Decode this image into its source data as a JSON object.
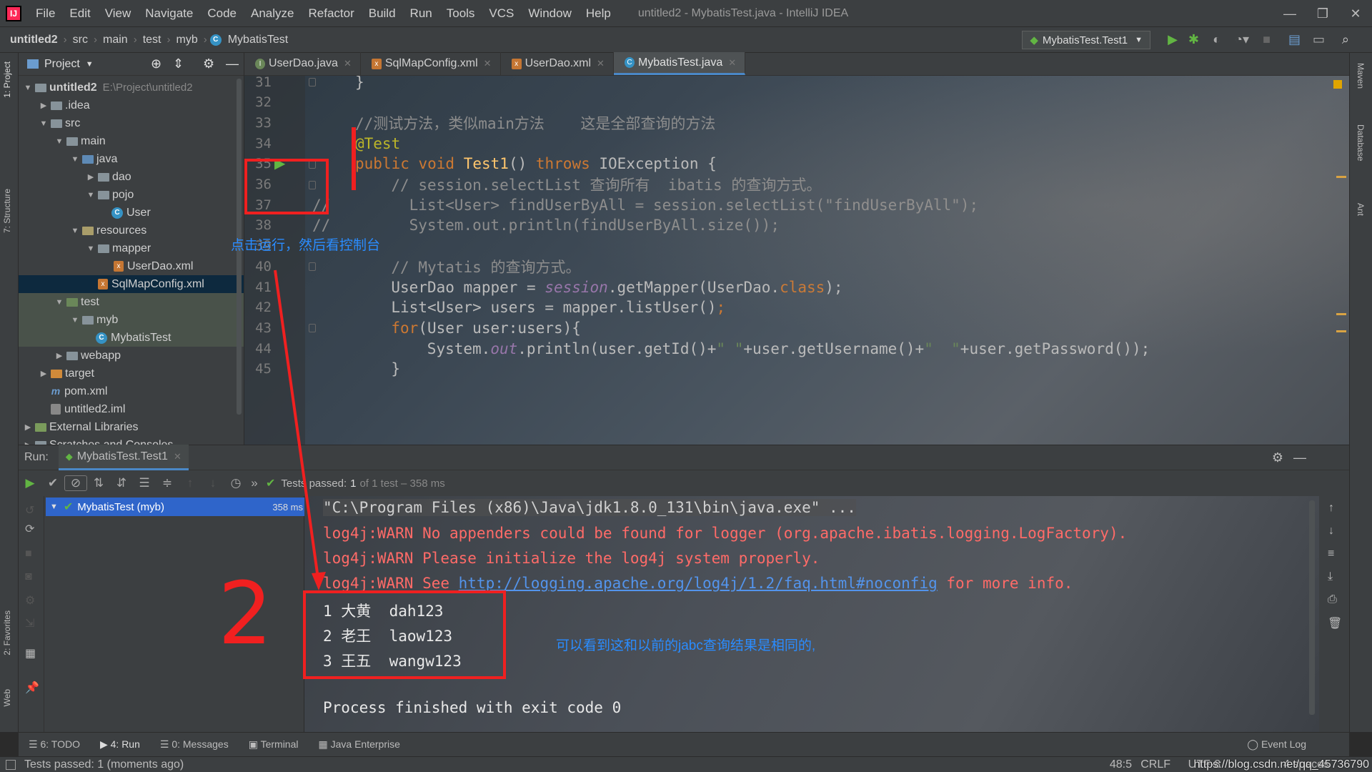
{
  "app": {
    "logo": "IJ"
  },
  "menu": [
    "File",
    "Edit",
    "View",
    "Navigate",
    "Code",
    "Analyze",
    "Refactor",
    "Build",
    "Run",
    "Tools",
    "VCS",
    "Window",
    "Help"
  ],
  "window_title": "untitled2 - MybatisTest.java - IntelliJ IDEA",
  "breadcrumb": [
    "untitled2",
    "src",
    "main",
    "test",
    "myb",
    "MybatisTest"
  ],
  "run_config": "MybatisTest.Test1",
  "left_tabs": [
    "1: Project",
    "7: Structure",
    "2: Favorites",
    "Web"
  ],
  "right_tabs": [
    "Maven",
    "Database",
    "Ant"
  ],
  "project": {
    "header": "Project",
    "tree": [
      {
        "label": "untitled2",
        "extra": "E:\\Project\\untitled2",
        "depth": 0,
        "arrow": "▼",
        "icon": "folder"
      },
      {
        "label": ".idea",
        "depth": 1,
        "arrow": "▶",
        "icon": "folder"
      },
      {
        "label": "src",
        "depth": 1,
        "arrow": "▼",
        "icon": "folder"
      },
      {
        "label": "main",
        "depth": 2,
        "arrow": "▼",
        "icon": "folder"
      },
      {
        "label": "java",
        "depth": 3,
        "arrow": "▼",
        "icon": "src"
      },
      {
        "label": "dao",
        "depth": 4,
        "arrow": "▶",
        "icon": "folder"
      },
      {
        "label": "pojo",
        "depth": 4,
        "arrow": "▼",
        "icon": "folder"
      },
      {
        "label": "User",
        "depth": 5,
        "arrow": "",
        "icon": "class"
      },
      {
        "label": "resources",
        "depth": 3,
        "arrow": "▼",
        "icon": "res"
      },
      {
        "label": "mapper",
        "depth": 4,
        "arrow": "▼",
        "icon": "folder"
      },
      {
        "label": "UserDao.xml",
        "depth": 5,
        "arrow": "",
        "icon": "xml"
      },
      {
        "label": "SqlMapConfig.xml",
        "depth": 4,
        "arrow": "",
        "icon": "xml"
      },
      {
        "label": "test",
        "depth": 2,
        "arrow": "▼",
        "icon": "test"
      },
      {
        "label": "myb",
        "depth": 3,
        "arrow": "▼",
        "icon": "folder"
      },
      {
        "label": "MybatisTest",
        "depth": 4,
        "arrow": "",
        "icon": "class"
      },
      {
        "label": "webapp",
        "depth": 2,
        "arrow": "▶",
        "icon": "folder"
      },
      {
        "label": "target",
        "depth": 1,
        "arrow": "▶",
        "icon": "orange"
      },
      {
        "label": "pom.xml",
        "depth": 1,
        "arrow": "",
        "icon": "maven"
      },
      {
        "label": "untitled2.iml",
        "depth": 1,
        "arrow": "",
        "icon": "iml"
      },
      {
        "label": "External Libraries",
        "depth": 0,
        "arrow": "▶",
        "icon": "lib"
      },
      {
        "label": "Scratches and Consoles",
        "depth": 0,
        "arrow": "▶",
        "icon": "folder"
      }
    ]
  },
  "editor_tabs": [
    {
      "label": "UserDao.java",
      "icon": "I",
      "color": "#6a8759"
    },
    {
      "label": "SqlMapConfig.xml",
      "icon": "x",
      "color": "#c57633"
    },
    {
      "label": "UserDao.xml",
      "icon": "x",
      "color": "#c57633"
    },
    {
      "label": "MybatisTest.java",
      "icon": "C",
      "color": "#3592c4"
    }
  ],
  "code": {
    "line_numbers": [
      "31",
      "32",
      "33",
      "34",
      "35",
      "36",
      "37",
      "38",
      "39",
      "40",
      "41",
      "42",
      "43",
      "44",
      "45"
    ],
    "l31": "}",
    "l33": "//测试方法，类似main方法    这是全部查询的方法",
    "l34": "@Test",
    "l35": {
      "kw1": "public void ",
      "fn": "Test1",
      "p": "() ",
      "kw2": "throws ",
      "ex": "IOException {"
    },
    "l36": "// session.selectList 查询所有  ibatis 的查询方式。",
    "l37": {
      "c": "//",
      "code": "List<User> findUserByAll = session.selectList(\"findUserByAll\");"
    },
    "l38": {
      "c": "//",
      "code": "System.out.println(findUserByAll.size());"
    },
    "l40": "// Mytatis 的查询方式。",
    "l41": {
      "a": "UserDao mapper = ",
      "b": "session",
      "c": ".getMapper(UserDao.",
      "d": "class",
      "e": ");"
    },
    "l42": {
      "a": "List<User> users = mapper.listUser()",
      "b": ";"
    },
    "l43": {
      "a": "for",
      "b": "(User user:users){"
    },
    "l44": {
      "a": "System.",
      "b": "out",
      "c": ".println(user.getId()+",
      "d": "\" \"",
      "e": "+user.getUsername()+",
      "f": "\"  \"",
      "g": "+user.getPassword());"
    },
    "l45": "}"
  },
  "run": {
    "label": "Run:",
    "tab": "MybatisTest.Test1",
    "status_prefix": "Tests passed:",
    "status_count": "1",
    "status_suffix": "of 1 test – 358 ms",
    "tree_item": "MybatisTest (myb)",
    "tree_time": "358 ms"
  },
  "console": {
    "cmd": "\"C:\\Program Files (x86)\\Java\\jdk1.8.0_131\\bin\\java.exe\" ...",
    "warn1": "log4j:WARN No appenders could be found for logger (org.apache.ibatis.logging.LogFactory).",
    "warn2": "log4j:WARN Please initialize the log4j system properly.",
    "warn3_pre": "log4j:WARN See ",
    "warn3_link": "http://logging.apache.org/log4j/1.2/faq.html#noconfig",
    "warn3_post": " for more info.",
    "rows": [
      "1 大黄  dah123",
      "2 老王  laow123",
      "3 王五  wangw123"
    ],
    "finish": "Process finished with exit code 0"
  },
  "annotations": {
    "note1": "点击运行，然后看控制台",
    "note2": "可以看到这和以前的jabc查询结果是相同的,",
    "digit": "2"
  },
  "bottom_tabs": [
    "6: TODO",
    "4: Run",
    "0: Messages",
    "Terminal",
    "Java Enterprise"
  ],
  "event_log": "Event Log",
  "status": {
    "text": "Tests passed: 1 (moments ago)",
    "position": "48:5",
    "crlf": "CRLF",
    "encoding": "UTF-8",
    "indent": "4 spaces",
    "watermark": "https://blog.csdn.net/qq_45736790"
  },
  "colors": {
    "annotation_red": "#f02020",
    "annotation_blue": "#2a8cff",
    "accent": "#4a88c7"
  }
}
